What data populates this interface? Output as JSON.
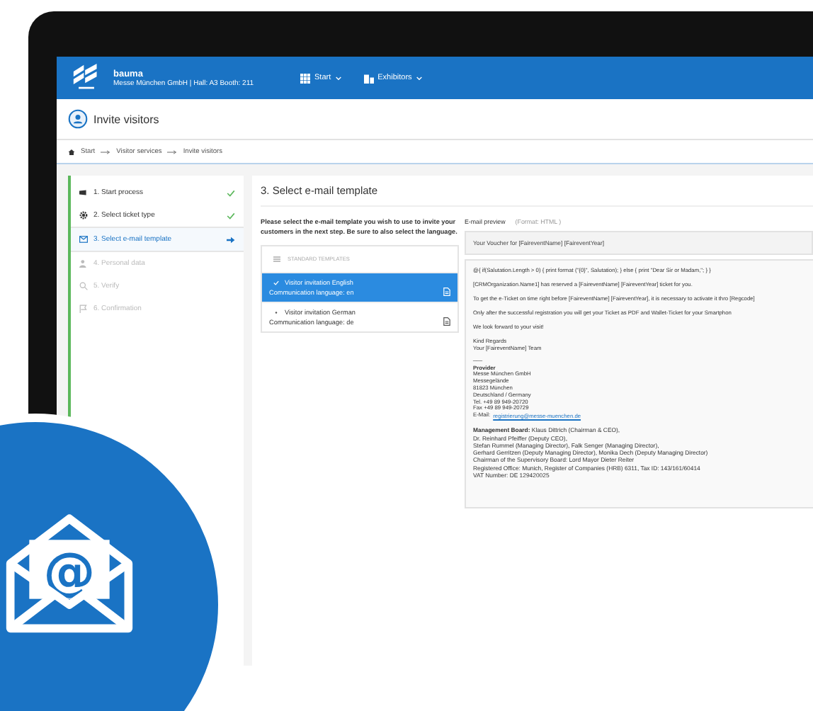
{
  "header": {
    "brand": "bauma",
    "subtitle": "Messe München GmbH | Hall: A3 Booth: 211",
    "menus": [
      {
        "label": "Start"
      },
      {
        "label": "Exhibitors"
      }
    ]
  },
  "page_title": "Invite visitors",
  "breadcrumb": [
    "Start",
    "Visitor services",
    "Invite visitors"
  ],
  "steps": [
    {
      "label": "1. Start process",
      "kind": "done"
    },
    {
      "label": "2. Select ticket type",
      "kind": "done"
    },
    {
      "label": "3. Select e-mail template",
      "kind": "current"
    },
    {
      "label": "4. Personal data",
      "kind": "pending"
    },
    {
      "label": "5. Verify",
      "kind": "pending"
    },
    {
      "label": "6. Confirmation",
      "kind": "pending"
    }
  ],
  "badge_symbol": "@",
  "section_title": "3. Select e-mail template",
  "instructions": "Please select the e-mail template you wish to use to invite your customers in the next step. Be sure to also select the language.",
  "templates": {
    "heading": "STANDARD TEMPLATES",
    "items": [
      {
        "name": "Visitor invitation English",
        "language": "Communication language: en",
        "selected": true
      },
      {
        "name": "Visitor invitation German",
        "language": "Communication language: de",
        "selected": false
      }
    ]
  },
  "preview": {
    "label": "E-mail preview",
    "format": "(Format: HTML )",
    "subject": "Your Voucher for [FaireventName] [FaireventYear]",
    "paragraphs": [
      "@{ if(Salutation.Length > 0) { print format (\"{0}\", Salutation); } else { print \"Dear Sir or Madam,\"; } }",
      "[CRMOrganization.Name1] has reserved a [FaireventName] [FaireventYear] ticket for you.",
      "To get the e-Ticket on time right before [FaireventName] [FaireventYear], it is necessary to activate it thro [Regcode]",
      "Only after the successful registration you will get your Ticket as PDF and Wallet-Ticket for your Smartphon",
      "We look forward to your visit!",
      "Kind Regards\nYour [FaireventName] Team"
    ],
    "separator": "___",
    "provider_heading": "Provider",
    "provider_lines": [
      "Messe München GmbH",
      "Messegelände",
      "81823 München",
      "Deutschland / Germany",
      "Tel. +49 89 949-20720",
      "Fax +49 89 949-20729"
    ],
    "email_label": "E-Mail:",
    "email_link": "registrierung@messe-muenchen.de",
    "legal": [
      "**Management Board:** Klaus Dittrich (Chairman & CEO),",
      "Dr. Reinhard Pfeiffer (Deputy CEO),",
      "Stefan Rummel (Managing Director), Falk Senger (Managing Director),",
      "Gerhard Gerritzen (Deputy Managing Director), Monika Dech (Deputy Managing Director)",
      "Chairman of the Supervisory Board: Lord Mayor Dieter Reiter",
      "Registered Office: Munich, Register of Companies (HRB) 6311, Tax ID: 143/161/60414",
      "VAT Number: DE 129420025"
    ]
  }
}
